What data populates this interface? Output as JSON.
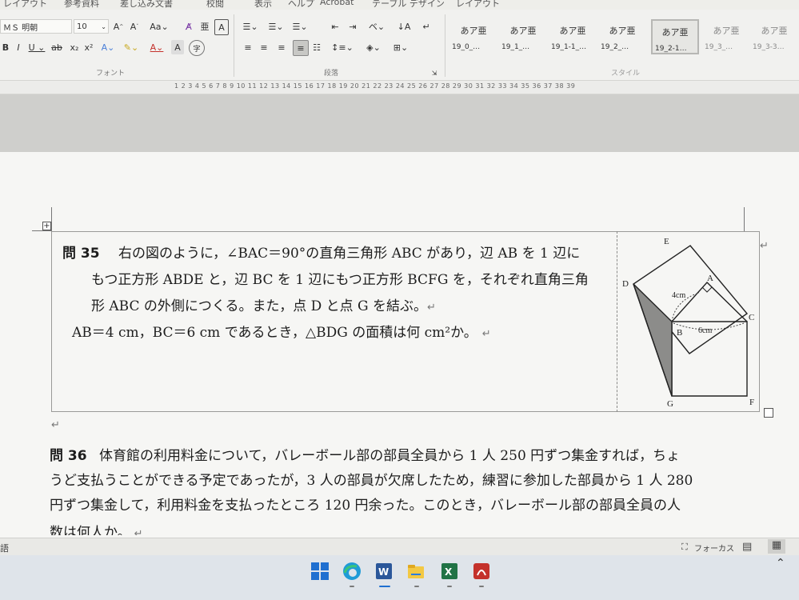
{
  "menu": {
    "tabs": [
      "レイアウト",
      "参考資料",
      "差し込み文書",
      "校閲",
      "表示",
      "ヘルプ",
      "Acrobat",
      "テーブル デザイン",
      "レイアウト"
    ]
  },
  "ribbon": {
    "font_name": "ＭＳ 明朝",
    "font_size": "10",
    "font_group_label": "フォント",
    "paragraph_group_label": "段落",
    "style_group_label": "スタイル",
    "style_sample": "あア亜",
    "styles": [
      "19_0_…",
      "19_1_…",
      "19_1-1_…",
      "19_2_…",
      "19_2-1…",
      "19_3_…",
      "19_3-3…"
    ]
  },
  "ruler": {
    "numbers": "1 2 3 4 5 6 7 8 9 10 11 12 13 14 15 16 17 18 19 20 21 22 23 24 25 26 27 28 29 30 31 32 33 34 35 36 37 38 39"
  },
  "problem35": {
    "number": "問 35",
    "line1": "右の図のように，∠BAC＝90°の直角三角形 ABC があり，辺 AB を 1 辺に",
    "line2": "もつ正方形 ABDE と，辺 BC を 1 辺にもつ正方形 BCFG を，それぞれ直角三角",
    "line3": "形 ABC の外側につくる。また，点 D と点 G を結ぶ。",
    "line4": "AB＝4 cm，BC＝6 cm であるとき，△BDG の面積は何 cm²か。"
  },
  "figure": {
    "points": {
      "A": "A",
      "B": "B",
      "C": "C",
      "D": "D",
      "E": "E",
      "F": "F",
      "G": "G"
    },
    "label_ab": "4cm",
    "label_bc": "6cm"
  },
  "problem36": {
    "number": "問 36",
    "line1": "体育館の利用料金について，バレーボール部の部員全員から 1 人 250 円ずつ集金すれば，ちょ",
    "line2": "うど支払うことができる予定であったが，3 人の部員が欠席したため，練習に参加した部員から 1 人 280",
    "line3": "円ずつ集金して，利用料金を支払ったところ 120 円余った。このとき，バレーボール部の部員全員の人",
    "line4": "数は何人か。"
  },
  "paragraph_mark": "↵",
  "status": {
    "language": "語",
    "focus": "フォーカス"
  },
  "taskbar": {
    "apps": [
      "start",
      "edge",
      "word",
      "file-explorer",
      "excel",
      "acrobat"
    ]
  },
  "colors": {
    "page_bg": "#f6f6f4",
    "ribbon_bg": "#f1f1ef",
    "word_blue": "#2b579a",
    "excel_green": "#217346",
    "acrobat_red": "#c4312b",
    "edge_teal": "#1f9bd7",
    "folder_yellow": "#f3c843",
    "windows_blue": "#1f6fd0"
  }
}
